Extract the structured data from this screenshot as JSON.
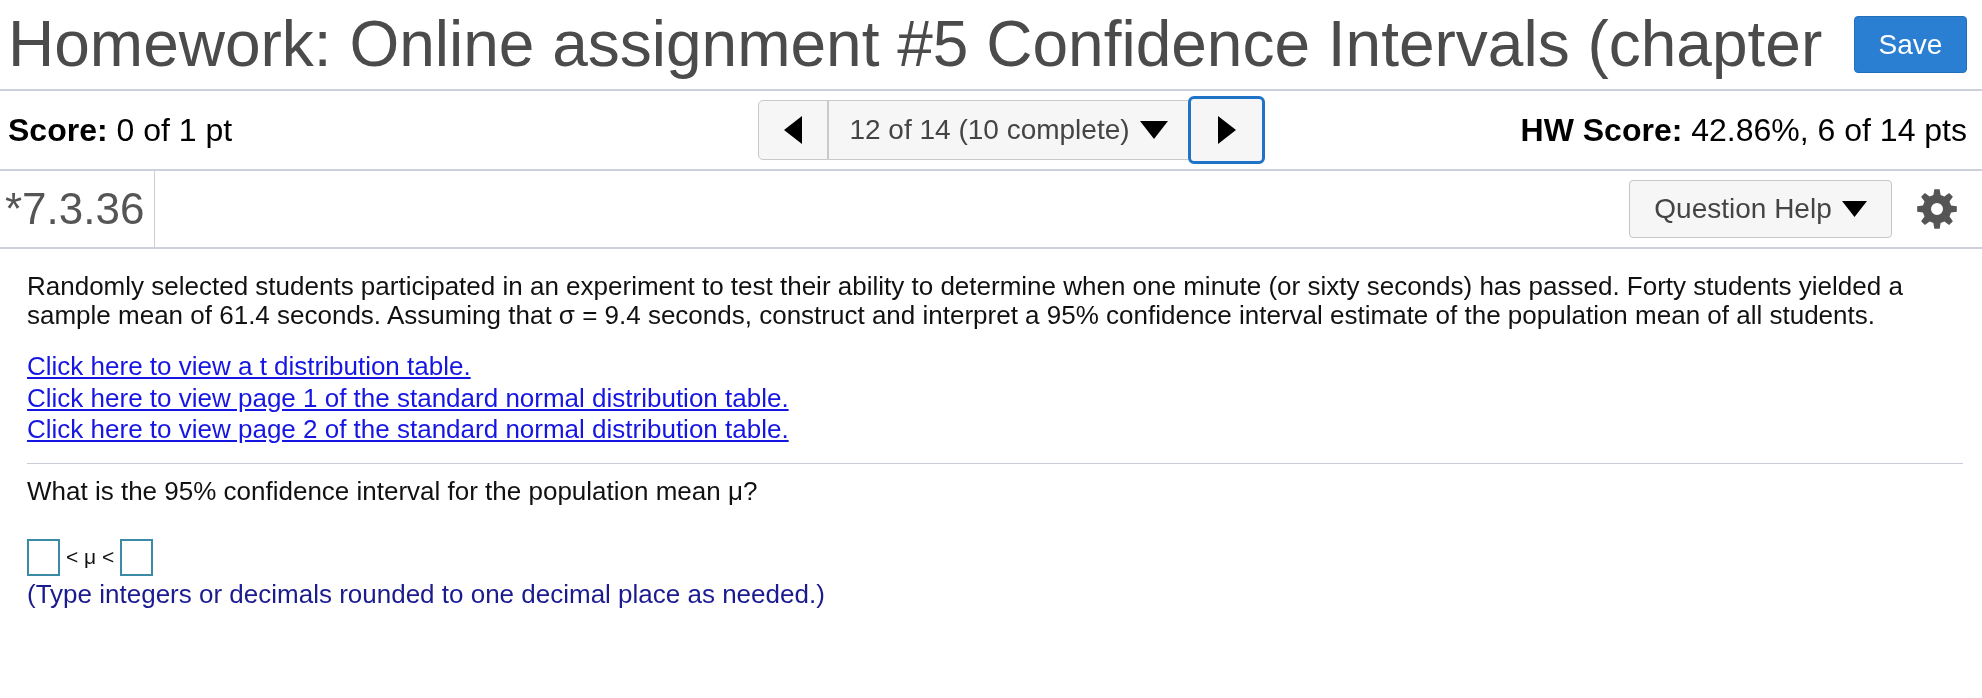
{
  "header": {
    "title": "Homework: Online assignment #5 Confidence Intervals (chapter",
    "save_label": "Save"
  },
  "score_bar": {
    "score": "**Score:** 0 of 1 pt",
    "pager": {
      "position": "12 of 14 (10 complete)",
      "next_focused": true
    },
    "hw_score": "**HW Score:** 42.86%, 6 of 14 pts"
  },
  "question_bar": {
    "number": "*7.3.36",
    "help_label": "Question Help"
  },
  "question": {
    "problem": "Randomly selected students participated in an experiment to test their ability to determine when one minute (or sixty seconds) has passed. Forty students yielded a sample mean of 61.4 seconds. Assuming that σ = 9.4 seconds, construct and interpret a 95% confidence interval estimate of the population mean of all students.",
    "links": [
      "Click here to view a t distribution table.",
      "Click here to view page 1 of the standard normal distribution table.",
      "Click here to view page 2 of the standard normal distribution table."
    ],
    "prompt": "What is the 95% confidence interval for the population mean μ?",
    "answer": [
      {
        "kind": "input"
      },
      {
        "kind": "text",
        "text": "< μ <"
      },
      {
        "kind": "input"
      }
    ],
    "hint": "(Type integers or decimals rounded to one decimal place as needed.)"
  }
}
